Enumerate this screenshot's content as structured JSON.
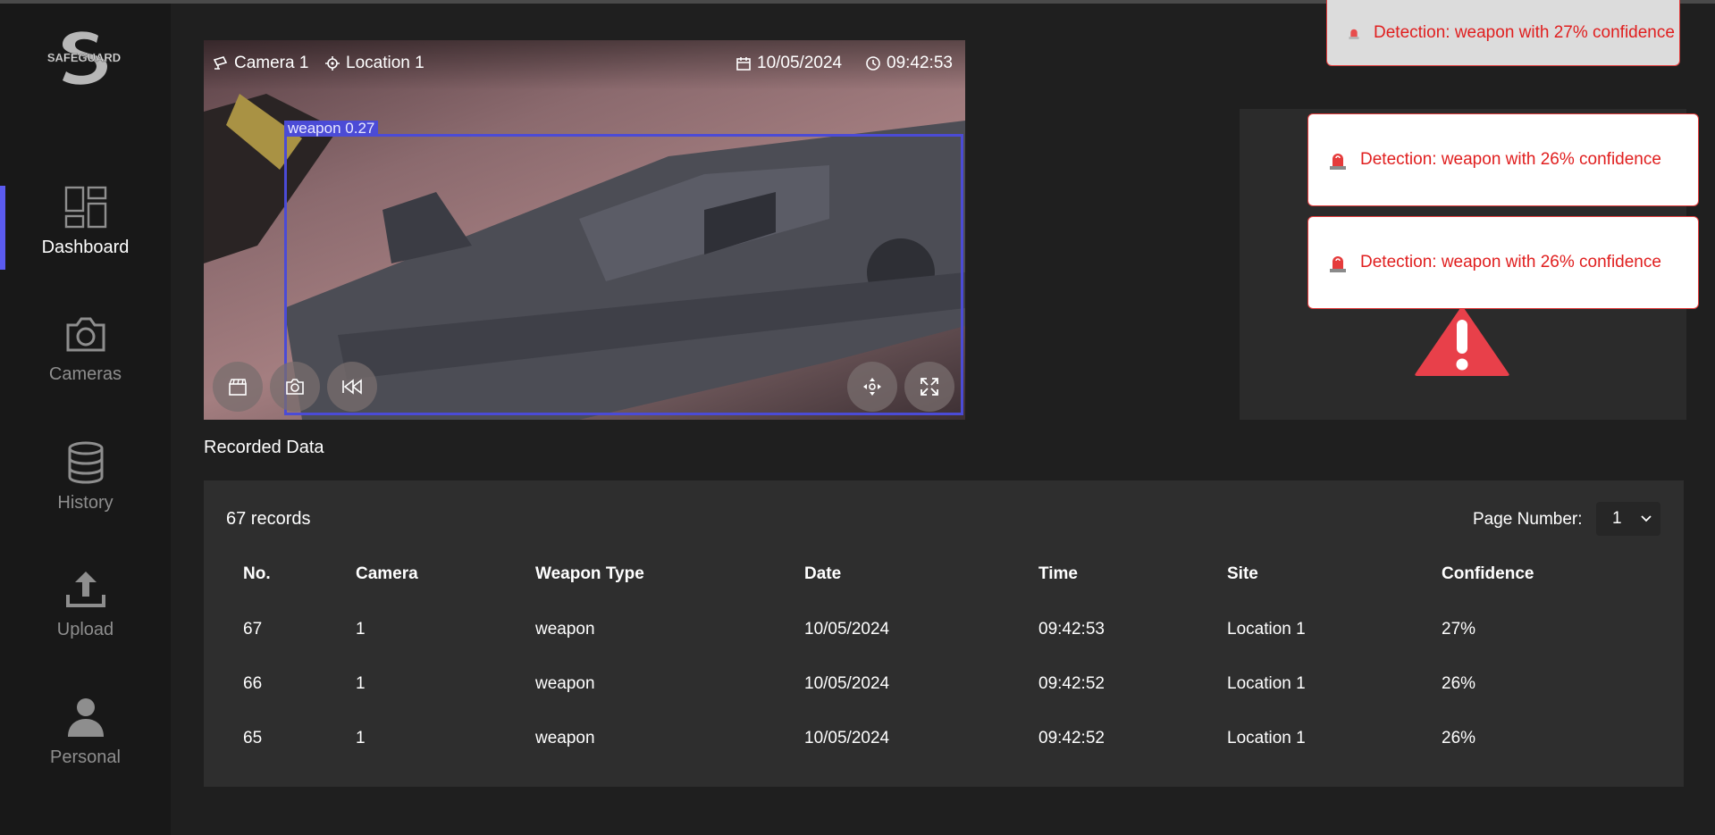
{
  "app": {
    "brand_logo_text": "SAFEGUARD"
  },
  "sidebar": {
    "items": [
      {
        "label": "Dashboard",
        "icon": "dashboard-grid-icon",
        "active": true
      },
      {
        "label": "Cameras",
        "icon": "camera-icon",
        "active": false
      },
      {
        "label": "History",
        "icon": "database-icon",
        "active": false
      },
      {
        "label": "Upload",
        "icon": "upload-icon",
        "active": false
      },
      {
        "label": "Personal",
        "icon": "person-icon",
        "active": false
      }
    ]
  },
  "video": {
    "camera": "Camera 1",
    "location": "Location 1",
    "date": "10/05/2024",
    "time": "09:42:53",
    "detection_label": "weapon  0.27",
    "controls_left": [
      "clapper-icon",
      "snapshot-icon",
      "rewind-icon"
    ],
    "controls_right": [
      "move-icon",
      "fullscreen-icon"
    ]
  },
  "toasts": [
    {
      "text": "Detection: weapon with 27% confidence",
      "faded": true
    },
    {
      "text": "Detection: weapon with 26% confidence",
      "faded": false
    },
    {
      "text": "Detection: weapon with 26% confidence",
      "faded": false
    }
  ],
  "recorded": {
    "title": "Recorded Data",
    "count_text": "67 records",
    "page_label": "Page Number:",
    "page_value": "1",
    "columns": [
      "No.",
      "Camera",
      "Weapon Type",
      "Date",
      "Time",
      "Site",
      "Confidence"
    ],
    "rows": [
      [
        "67",
        "1",
        "weapon",
        "10/05/2024",
        "09:42:53",
        "Location 1",
        "27%"
      ],
      [
        "66",
        "1",
        "weapon",
        "10/05/2024",
        "09:42:52",
        "Location 1",
        "26%"
      ],
      [
        "65",
        "1",
        "weapon",
        "10/05/2024",
        "09:42:52",
        "Location 1",
        "26%"
      ]
    ]
  },
  "colors": {
    "accent": "#5b5bf0",
    "alert": "#e01e1e",
    "bbox": "#4b4bd6"
  }
}
